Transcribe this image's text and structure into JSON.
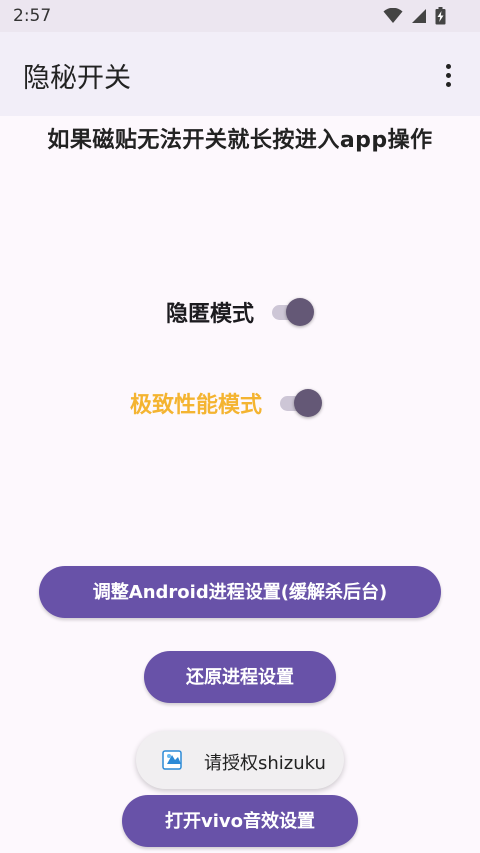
{
  "status_bar": {
    "time": "2:57"
  },
  "app_bar": {
    "title": "隐秘开关",
    "menu_icon": "more-vert-icon"
  },
  "hint_text": "如果磁贴无法开关就长按进入app操作",
  "switches": [
    {
      "label": "隐匿模式",
      "checked": true,
      "label_color": "#1c1b1f"
    },
    {
      "label": "极致性能模式",
      "checked": true,
      "label_color": "#f4b431"
    }
  ],
  "buttons": {
    "adjust": "调整Android进程设置(缓解杀后台)",
    "restore": "还原进程设置",
    "vivo_sound": "打开vivo音效设置"
  },
  "toast": {
    "text": "请授权shizuku",
    "icon": "shizuku-app-icon"
  },
  "colors": {
    "accent": "#6852a8",
    "toggle_thumb": "#645876",
    "app_bar_bg": "#f2eef8"
  }
}
